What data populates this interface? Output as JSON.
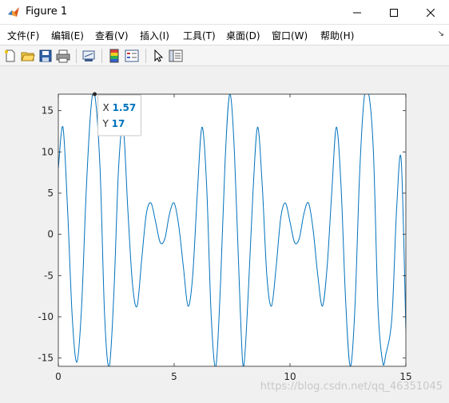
{
  "window": {
    "title": "Figure 1"
  },
  "menu": [
    {
      "label": "文件(F)"
    },
    {
      "label": "编辑(E)"
    },
    {
      "label": "查看(V)"
    },
    {
      "label": "插入(I)"
    },
    {
      "label": "工具(T)"
    },
    {
      "label": "桌面(D)"
    },
    {
      "label": "窗口(W)"
    },
    {
      "label": "帮助(H)"
    }
  ],
  "toolbar_icons": [
    "new-figure-icon",
    "open-file-icon",
    "save-icon",
    "print-icon",
    "link-plot-icon",
    "insert-colorbar-icon",
    "insert-legend-icon",
    "edit-plot-icon",
    "property-inspector-icon"
  ],
  "datatip": {
    "x_label": "X",
    "x_value": "1.57",
    "y_label": "Y",
    "y_value": "17"
  },
  "colors": {
    "line": "#0072BD",
    "datatip_value": "#0072BD",
    "axes_bg": "#ffffff"
  },
  "watermark": "https://blog.csdn.net/qq_46351045",
  "chart_data": {
    "type": "line",
    "title": "",
    "xlabel": "",
    "ylabel": "",
    "xlim": [
      0,
      15
    ],
    "ylim": [
      -16,
      17
    ],
    "xticks": [
      0,
      5,
      10,
      15
    ],
    "yticks": [
      -15,
      -10,
      -5,
      0,
      5,
      10,
      15
    ],
    "grid": false,
    "series": [
      {
        "x": [
          0,
          0.2,
          0.4,
          0.6,
          0.8,
          1.0,
          1.2,
          1.4,
          1.57,
          1.8,
          2.0,
          2.2,
          2.4,
          2.6,
          2.8,
          3.0,
          3.2,
          3.4,
          3.6,
          3.8,
          4.0,
          4.2,
          4.4,
          4.6,
          4.8,
          5.0,
          5.2,
          5.4,
          5.6,
          5.8,
          6.0,
          6.2,
          6.4,
          6.6,
          6.8,
          7.0,
          7.2,
          7.4,
          7.6,
          7.85,
          8.0,
          8.2,
          8.4,
          8.6,
          8.8,
          9.0,
          9.2,
          9.4,
          9.6,
          9.8,
          10.0,
          10.2,
          10.4,
          10.6,
          10.8,
          11.0,
          11.2,
          11.4,
          11.6,
          11.8,
          12.0,
          12.2,
          12.4,
          12.6,
          12.8,
          13.0,
          13.2,
          13.4,
          13.6,
          13.8,
          14.0,
          14.14,
          14.4,
          14.6,
          14.8,
          15.0
        ],
        "y": [
          8.0,
          13.0,
          3.0,
          -10.0,
          -15.5,
          -9.0,
          5.0,
          15.0,
          17.0,
          8.0,
          -10.0,
          -16.0,
          -7.0,
          8.0,
          13.0,
          3.0,
          -6.0,
          -8.7,
          -3.0,
          2.5,
          3.8,
          1.5,
          -1.0,
          -0.5,
          2.5,
          3.8,
          1.0,
          -4.0,
          -8.7,
          -5.0,
          5.0,
          13.0,
          6.0,
          -10.0,
          -16.0,
          -6.0,
          9.0,
          17.0,
          10.0,
          -9.0,
          -16.0,
          -7.0,
          5.0,
          13.0,
          6.0,
          -5.0,
          -8.7,
          -4.0,
          2.0,
          3.8,
          1.5,
          -1.0,
          -0.5,
          2.5,
          3.8,
          0.5,
          -5.0,
          -8.7,
          -4.0,
          5.0,
          13.0,
          6.0,
          -8.0,
          -16.0,
          -9.0,
          7.0,
          16.5,
          17.0,
          10.0,
          -9.0,
          -15.5,
          -14.5,
          -10.0,
          3.0,
          9.0,
          -11.5
        ]
      }
    ]
  }
}
